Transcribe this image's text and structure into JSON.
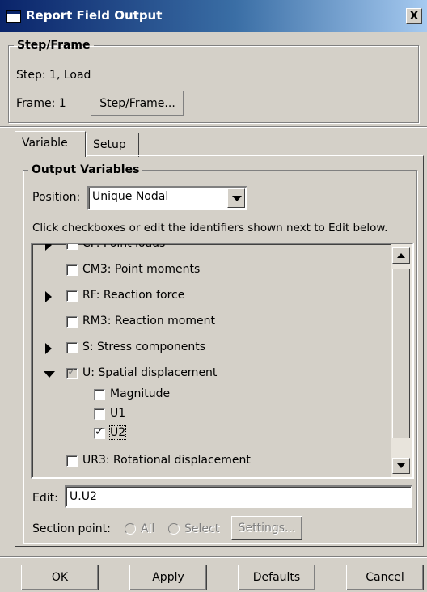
{
  "window": {
    "title": "Report Field Output",
    "close_label": "X"
  },
  "step_frame": {
    "legend": "Step/Frame",
    "step_text": "Step: 1, Load",
    "frame_text": "Frame:  1",
    "step_frame_button": "Step/Frame..."
  },
  "tabs": [
    {
      "label": "Variable",
      "active": true
    },
    {
      "label": "Setup",
      "active": false
    }
  ],
  "output_variables": {
    "legend": "Output Variables",
    "position_label": "Position:",
    "position_value": "Unique Nodal",
    "instruction": "Click checkboxes or edit the identifiers shown next to Edit below.",
    "items": [
      {
        "label": "CF: Point loads",
        "expander": "collapsed",
        "checked": false
      },
      {
        "label": "CM3: Point moments",
        "expander": "none",
        "checked": false
      },
      {
        "label": "RF: Reaction force",
        "expander": "collapsed",
        "checked": false
      },
      {
        "label": "RM3: Reaction moment",
        "expander": "none",
        "checked": false
      },
      {
        "label": "S: Stress components",
        "expander": "collapsed",
        "checked": false
      },
      {
        "label": "U: Spatial displacement",
        "expander": "expanded",
        "checked": true,
        "partial": true
      },
      {
        "label": "Magnitude",
        "expander": "none",
        "checked": false,
        "child": true
      },
      {
        "label": "U1",
        "expander": "none",
        "checked": false,
        "child": true
      },
      {
        "label": "U2",
        "expander": "none",
        "checked": true,
        "child": true
      },
      {
        "label": "UR3: Rotational displacement",
        "expander": "none",
        "checked": false
      }
    ],
    "edit_label": "Edit:",
    "edit_value": "U.U2",
    "section_point_label": "Section point:",
    "all_label": "All",
    "select_label": "Select",
    "settings_button": "Settings..."
  },
  "footer": {
    "ok": "OK",
    "apply": "Apply",
    "defaults": "Defaults",
    "cancel": "Cancel"
  }
}
